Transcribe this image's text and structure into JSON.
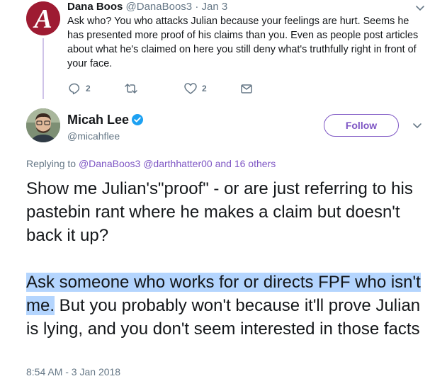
{
  "parent_tweet": {
    "name": "Dana Boos",
    "handle": "@DanaBoos3",
    "date": "· Jan 3",
    "text": "Ask who? You who attacks Julian because your feelings are hurt. Seems he has presented more proof of his claims than you. Even as people post articles about what he's claimed on here you still deny what's truthfully right in front of your face.",
    "reply_count": "2",
    "like_count": "2",
    "avatar_letter": "A"
  },
  "main_tweet": {
    "name": "Micah Lee",
    "handle": "@micahflee",
    "follow_label": "Follow",
    "replying_prefix": "Replying to ",
    "replying_users": "@DanaBoos3 @darthhatter00",
    "replying_suffix": " and 16 others",
    "paragraph1": "Show me Julian's\"proof\" - or are just referring to his pastebin rant where he makes a claim but doesn't back it up?",
    "paragraph2_highlighted": "Ask someone who works for or directs FPF who isn't me.",
    "paragraph2_rest": " But you probably won't because it'll prove Julian is lying, and you don't seem interested in those facts",
    "timestamp": "8:54 AM - 3 Jan 2018"
  },
  "colors": {
    "accent": "#7e56c4",
    "muted": "#657786",
    "highlight": "#b4d5fe",
    "verified": "#1da1f2",
    "alabama_crimson": "#9e1b32"
  }
}
